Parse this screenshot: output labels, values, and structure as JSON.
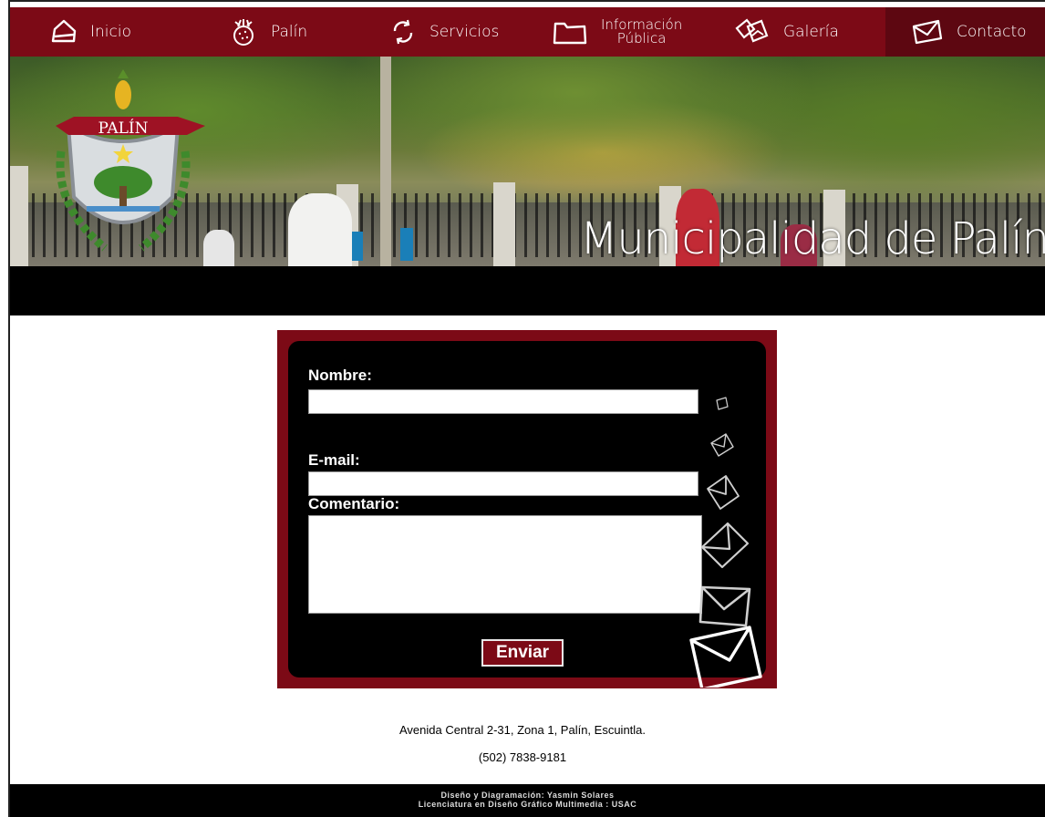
{
  "nav": {
    "items": [
      {
        "label": "Inicio",
        "icon": "house-icon"
      },
      {
        "label": "Palín",
        "icon": "pineapple-icon"
      },
      {
        "label": "Servicios",
        "icon": "refresh-icon"
      },
      {
        "label_line1": "Información",
        "label_line2": "Pública",
        "icon": "folder-icon"
      },
      {
        "label": "Galería",
        "icon": "photos-icon"
      },
      {
        "label": "Contacto",
        "icon": "envelope-icon",
        "active": true
      }
    ]
  },
  "banner": {
    "title": "Municipalidad de Palín",
    "shield_text": "PALÍN"
  },
  "form": {
    "name_label": "Nombre:",
    "email_label": "E-mail:",
    "comment_label": "Comentario:",
    "submit_label": "Enviar",
    "name_value": "",
    "email_value": "",
    "comment_value": ""
  },
  "contact": {
    "address": "Avenida Central 2-31, Zona 1, Palín, Escuintla.",
    "phone": "(502) 7838-9181"
  },
  "footer": {
    "line1": "Diseño y Diagramación: Yasmin Solares",
    "line2": "Licenciatura en Diseño Gráfico Multimedia : USAC"
  },
  "colors": {
    "brand": "#7c0a16",
    "brand_dark": "#5d0711",
    "black": "#000000"
  }
}
